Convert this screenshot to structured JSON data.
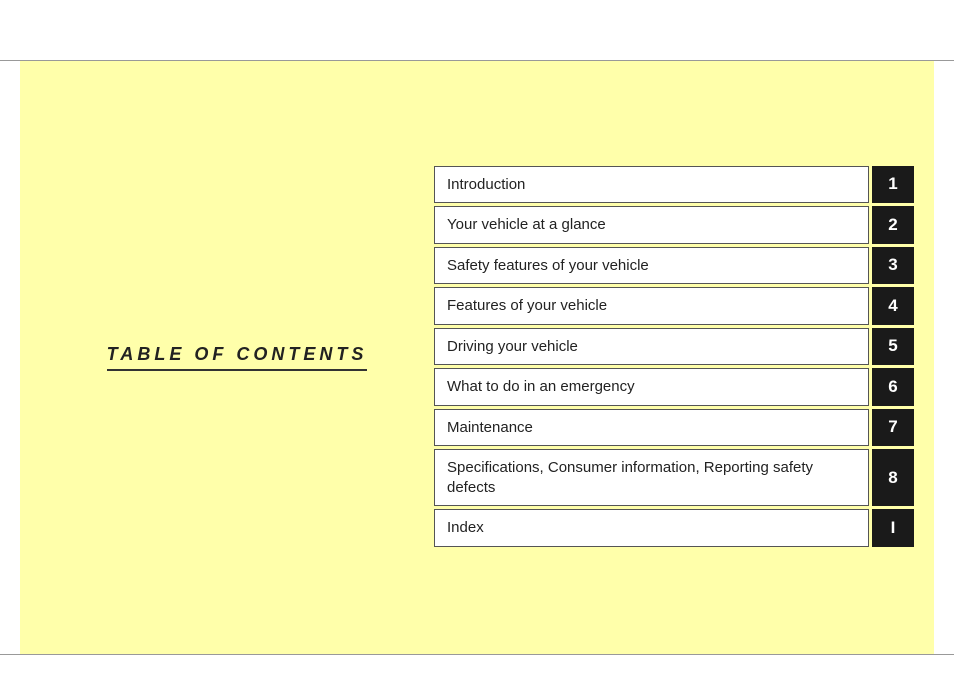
{
  "page": {
    "title": "TABLE OF CONTENTS"
  },
  "toc": {
    "items": [
      {
        "id": "intro",
        "label": "Introduction",
        "number": "1"
      },
      {
        "id": "glance",
        "label": "Your vehicle at a glance",
        "number": "2"
      },
      {
        "id": "safety",
        "label": "Safety features of your vehicle",
        "number": "3"
      },
      {
        "id": "features",
        "label": "Features of your vehicle",
        "number": "4"
      },
      {
        "id": "driving",
        "label": "Driving your vehicle",
        "number": "5"
      },
      {
        "id": "emergency",
        "label": "What to do in an emergency",
        "number": "6"
      },
      {
        "id": "maintenance",
        "label": "Maintenance",
        "number": "7"
      },
      {
        "id": "specifications",
        "label": "Specifications, Consumer information, Reporting safety defects",
        "number": "8"
      },
      {
        "id": "index",
        "label": "Index",
        "number": "I"
      }
    ]
  }
}
